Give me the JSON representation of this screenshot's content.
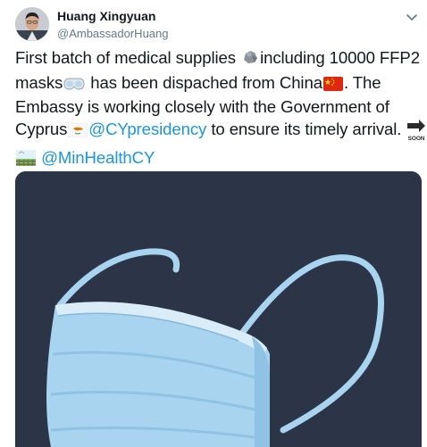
{
  "tweet": {
    "author": {
      "display_name": "Huang Xingyuan",
      "handle": "@AmbassadorHuang"
    },
    "text": {
      "line1_before": "First batch of medical supplies ",
      "line1_after": "including 10000 FFP2",
      "line2_before": "masks",
      "line2_after": " has been dispached from China",
      "line2_end": ". The",
      "line3": "Embassy is working closely with the Government of",
      "line4_before": "Cyprus",
      "mention1": "@CYpresidency",
      "line4_after": " to ensure its timely arrival.",
      "mention2": "@MinHealthCY"
    },
    "emoji_icons": [
      "rock-icon",
      "goggles-icon",
      "china-flag-icon",
      "cyprus-flag-icon",
      "soon-arrow-icon",
      "railway-track-icon"
    ],
    "soon_label": "SOON",
    "media": {
      "description_icon": "face-mask-icon"
    }
  },
  "colors": {
    "mention": "#1b95e0",
    "text": "#14171a",
    "secondary": "#657786",
    "media_background": "#2b3547",
    "mask_blue": "#a9d4ef"
  }
}
